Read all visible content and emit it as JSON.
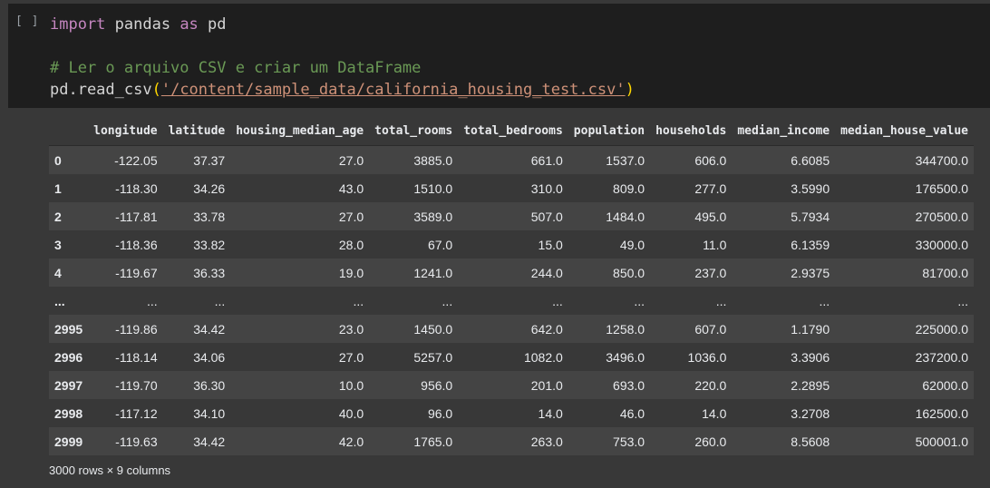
{
  "cell": {
    "run_indicator": "[ ]",
    "code": {
      "line1": {
        "kw1": "import",
        "t1": " pandas ",
        "kw2": "as",
        "t2": " pd"
      },
      "line2": {
        "comment": "# Ler o arquivo CSV e criar um DataFrame"
      },
      "line3": {
        "fn": "pd.read_csv",
        "open": "(",
        "str": "'/content/sample_data/california_housing_test.csv'",
        "close": ")"
      }
    }
  },
  "table": {
    "columns": [
      "longitude",
      "latitude",
      "housing_median_age",
      "total_rooms",
      "total_bedrooms",
      "population",
      "households",
      "median_income",
      "median_house_value"
    ],
    "rows": [
      {
        "index": "0",
        "cells": [
          "-122.05",
          "37.37",
          "27.0",
          "3885.0",
          "661.0",
          "1537.0",
          "606.0",
          "6.6085",
          "344700.0"
        ]
      },
      {
        "index": "1",
        "cells": [
          "-118.30",
          "34.26",
          "43.0",
          "1510.0",
          "310.0",
          "809.0",
          "277.0",
          "3.5990",
          "176500.0"
        ]
      },
      {
        "index": "2",
        "cells": [
          "-117.81",
          "33.78",
          "27.0",
          "3589.0",
          "507.0",
          "1484.0",
          "495.0",
          "5.7934",
          "270500.0"
        ]
      },
      {
        "index": "3",
        "cells": [
          "-118.36",
          "33.82",
          "28.0",
          "67.0",
          "15.0",
          "49.0",
          "11.0",
          "6.1359",
          "330000.0"
        ]
      },
      {
        "index": "4",
        "cells": [
          "-119.67",
          "36.33",
          "19.0",
          "1241.0",
          "244.0",
          "850.0",
          "237.0",
          "2.9375",
          "81700.0"
        ]
      },
      {
        "index": "...",
        "cells": [
          "...",
          "...",
          "...",
          "...",
          "...",
          "...",
          "...",
          "...",
          "..."
        ]
      },
      {
        "index": "2995",
        "cells": [
          "-119.86",
          "34.42",
          "23.0",
          "1450.0",
          "642.0",
          "1258.0",
          "607.0",
          "1.1790",
          "225000.0"
        ]
      },
      {
        "index": "2996",
        "cells": [
          "-118.14",
          "34.06",
          "27.0",
          "5257.0",
          "1082.0",
          "3496.0",
          "1036.0",
          "3.3906",
          "237200.0"
        ]
      },
      {
        "index": "2997",
        "cells": [
          "-119.70",
          "36.30",
          "10.0",
          "956.0",
          "201.0",
          "693.0",
          "220.0",
          "2.2895",
          "62000.0"
        ]
      },
      {
        "index": "2998",
        "cells": [
          "-117.12",
          "34.10",
          "40.0",
          "96.0",
          "14.0",
          "46.0",
          "14.0",
          "3.2708",
          "162500.0"
        ]
      },
      {
        "index": "2999",
        "cells": [
          "-119.63",
          "34.42",
          "42.0",
          "1765.0",
          "263.0",
          "753.0",
          "260.0",
          "8.5608",
          "500001.0"
        ]
      }
    ],
    "shape_label": "3000 rows × 9 columns"
  },
  "colors": {
    "background": "#383838",
    "editor_bg": "#1e1e1e",
    "row_stripe": "#444444",
    "keyword": "#c586c0",
    "comment": "#6a9955",
    "string": "#ce9178"
  }
}
